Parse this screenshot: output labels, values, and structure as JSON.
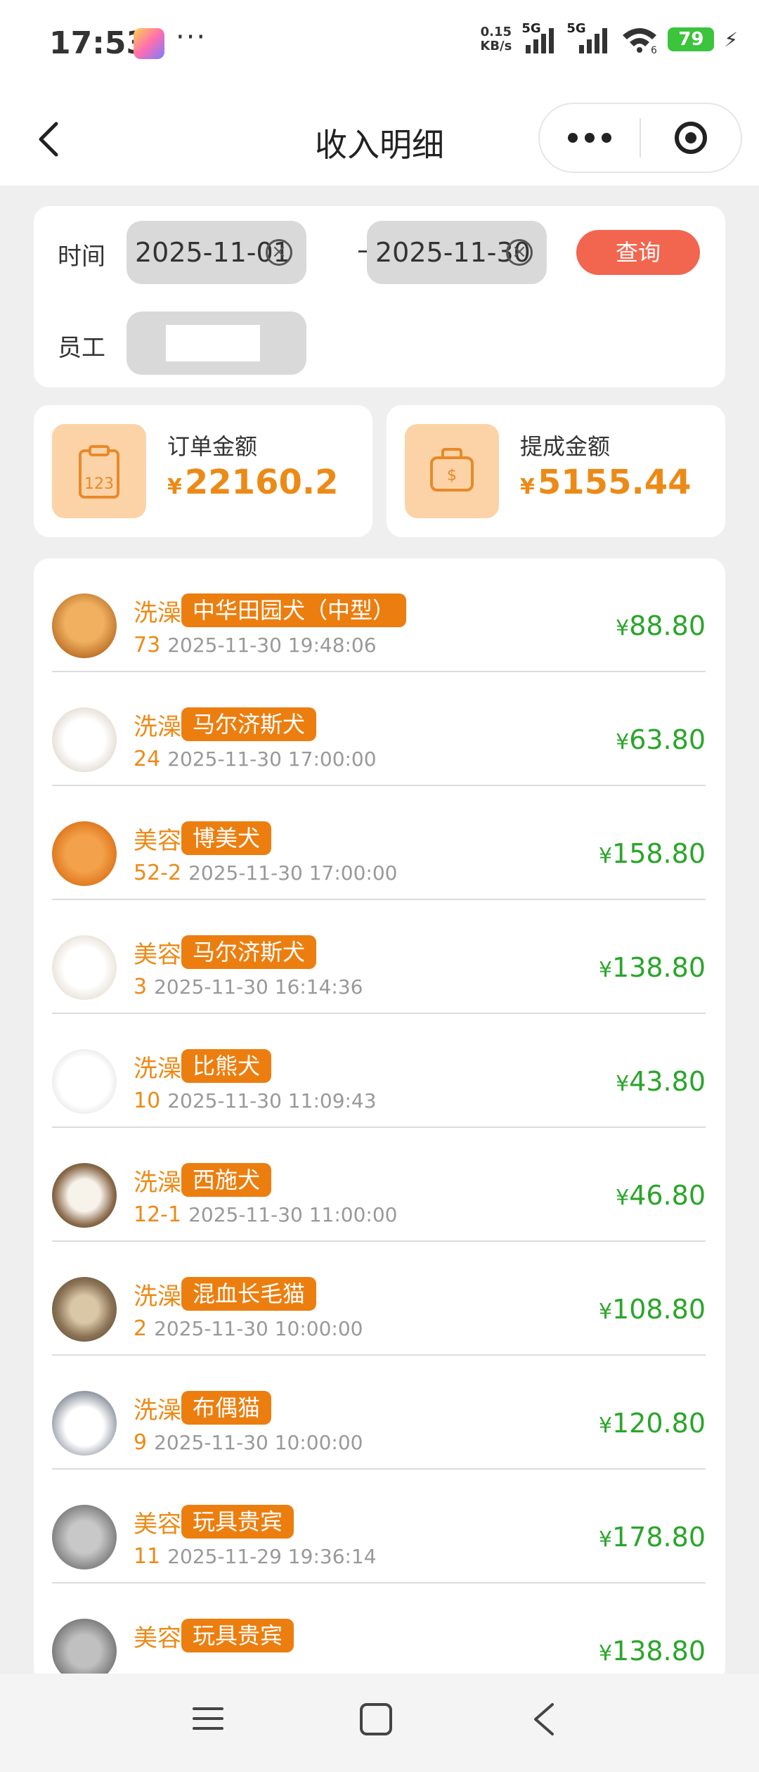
{
  "status_bar": {
    "time": "17:53",
    "dots": "···",
    "net_speed_value": "0.15",
    "net_speed_unit": "KB/s",
    "signal1_label": "5G",
    "signal2_label": "5G",
    "wifi_sub": "6",
    "battery": "79"
  },
  "nav": {
    "title": "收入明细"
  },
  "filter": {
    "time_label": "时间",
    "start_date": "2025-11-01",
    "dash": "—",
    "end_date": "2025-11-30",
    "query_label": "查询",
    "staff_label": "员工"
  },
  "summary": {
    "currency": "¥",
    "order": {
      "label": "订单金额",
      "value": "22160.2",
      "icon": "clipboard-123-icon"
    },
    "commission": {
      "label": "提成金额",
      "value": "5155.44",
      "icon": "money-bag-icon"
    }
  },
  "records": [
    {
      "service": "洗澡",
      "breed": "中华田园犬（中型）",
      "number": "73",
      "datetime": "2025-11-30 19:48:06",
      "amount": "88.80"
    },
    {
      "service": "洗澡",
      "breed": "马尔济斯犬",
      "number": "24",
      "datetime": "2025-11-30 17:00:00",
      "amount": "63.80"
    },
    {
      "service": "美容",
      "breed": "博美犬",
      "number": "52-2",
      "datetime": "2025-11-30 17:00:00",
      "amount": "158.80"
    },
    {
      "service": "美容",
      "breed": "马尔济斯犬",
      "number": "3",
      "datetime": "2025-11-30 16:14:36",
      "amount": "138.80"
    },
    {
      "service": "洗澡",
      "breed": "比熊犬",
      "number": "10",
      "datetime": "2025-11-30 11:09:43",
      "amount": "43.80"
    },
    {
      "service": "洗澡",
      "breed": "西施犬",
      "number": "12-1",
      "datetime": "2025-11-30 11:00:00",
      "amount": "46.80"
    },
    {
      "service": "洗澡",
      "breed": "混血长毛猫",
      "number": "2",
      "datetime": "2025-11-30 10:00:00",
      "amount": "108.80"
    },
    {
      "service": "洗澡",
      "breed": "布偶猫",
      "number": "9",
      "datetime": "2025-11-30 10:00:00",
      "amount": "120.80"
    },
    {
      "service": "美容",
      "breed": "玩具贵宾",
      "number": "11",
      "datetime": "2025-11-29 19:36:14",
      "amount": "178.80"
    },
    {
      "service": "美容",
      "breed": "玩具贵宾",
      "number": "",
      "datetime": "",
      "amount": "138.80"
    }
  ],
  "colors": {
    "accent": "#ec8a17",
    "tag": "#ec7e0f",
    "query": "#f2654f",
    "amount": "#2aa52a"
  }
}
